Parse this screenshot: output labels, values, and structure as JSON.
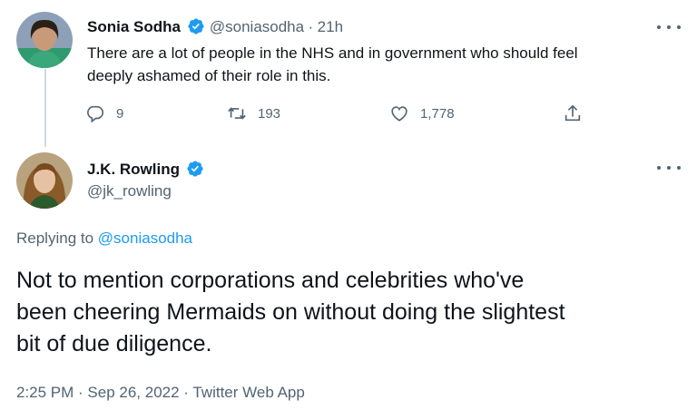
{
  "parent_tweet": {
    "author_name": "Sonia Sodha",
    "handle": "@soniasodha",
    "separator": "·",
    "time_ago": "21h",
    "text_line1": "There are a lot of people in the NHS and in government who should feel",
    "text_line2": "deeply ashamed of their role in this.",
    "replies": "9",
    "retweets": "193",
    "likes": "1,778"
  },
  "main_tweet": {
    "author_name": "J.K. Rowling",
    "handle": "@jk_rowling",
    "replying_prefix": "Replying to",
    "replying_to": "@soniasodha",
    "text_line1": "Not to mention corporations and celebrities who've",
    "text_line2": "been cheering Mermaids on without doing the slightest",
    "text_line3": "bit of due diligence.",
    "meta": "2:25 PM · Sep 26, 2022 · Twitter Web App"
  },
  "colors": {
    "verified": "#1d9bf0",
    "link": "#1d9bf0",
    "secondary_text": "#536471"
  },
  "icons": [
    "verified-badge-icon",
    "reply-icon",
    "retweet-icon",
    "like-icon",
    "share-icon",
    "more-options-icon"
  ]
}
